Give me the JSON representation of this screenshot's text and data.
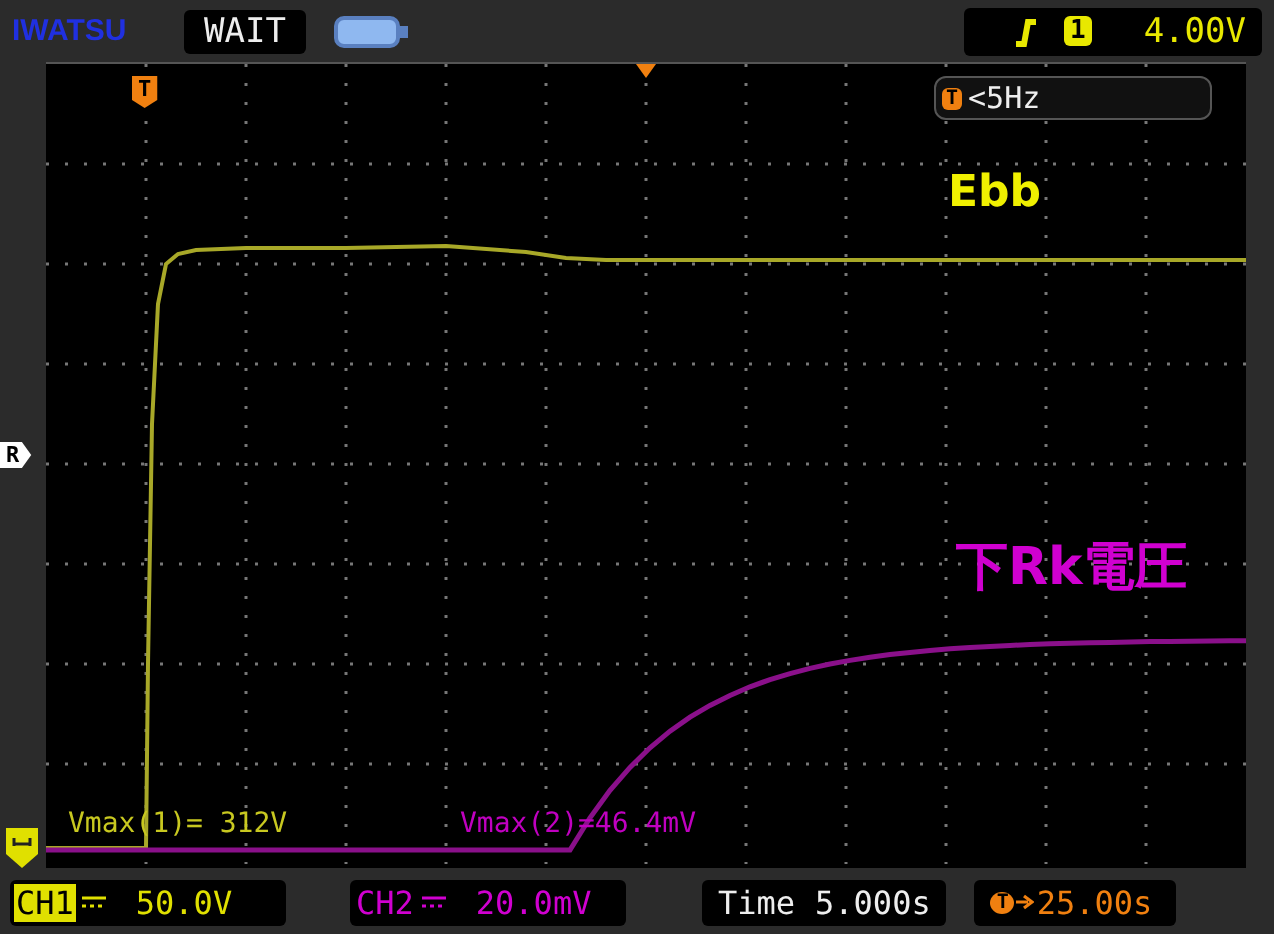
{
  "header": {
    "brand": "IWATSU",
    "status": "WAIT",
    "trigger": {
      "channel": "1",
      "level": "4.00V"
    }
  },
  "screen": {
    "trigger_marker": "T",
    "trigger_frequency": {
      "icon": "T",
      "text": "<5Hz"
    },
    "reference_marker": "R",
    "labels": [
      {
        "text": "Ebb",
        "color": "#f0f000"
      },
      {
        "text": "下Rk電圧",
        "color": "#d000d0"
      }
    ],
    "measurements": [
      {
        "text": "Vmax(1)= 312V",
        "color": "#c8c820"
      },
      {
        "text": "Vmax(2)=46.4mV",
        "color": "#c000c0"
      }
    ]
  },
  "footer": {
    "channels": [
      {
        "name": "CH1",
        "scale": "50.0V",
        "color": "#e0e000",
        "selected": true
      },
      {
        "name": "CH2",
        "scale": "20.0mV",
        "color": "#d000d0",
        "selected": false
      }
    ],
    "time": {
      "label": "Time",
      "value": "5.000s"
    },
    "delay": {
      "icon": "T",
      "value": "25.00s"
    }
  }
}
